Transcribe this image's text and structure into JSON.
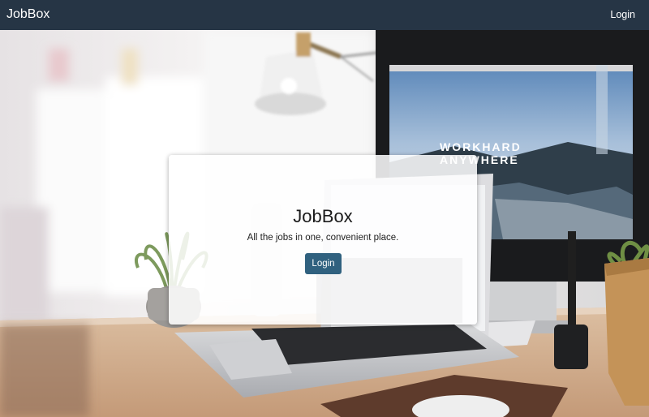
{
  "navbar": {
    "brand": "JobBox",
    "login_label": "Login",
    "background": "#263545"
  },
  "hero": {
    "title": "JobBox",
    "tagline": "All the jobs in one, convenient place.",
    "login_label": "Login",
    "button_color": "#30617f"
  },
  "background_photo": {
    "monitor_text_line1": "WORKHARD",
    "monitor_text_line2": "ANYWHERE"
  }
}
